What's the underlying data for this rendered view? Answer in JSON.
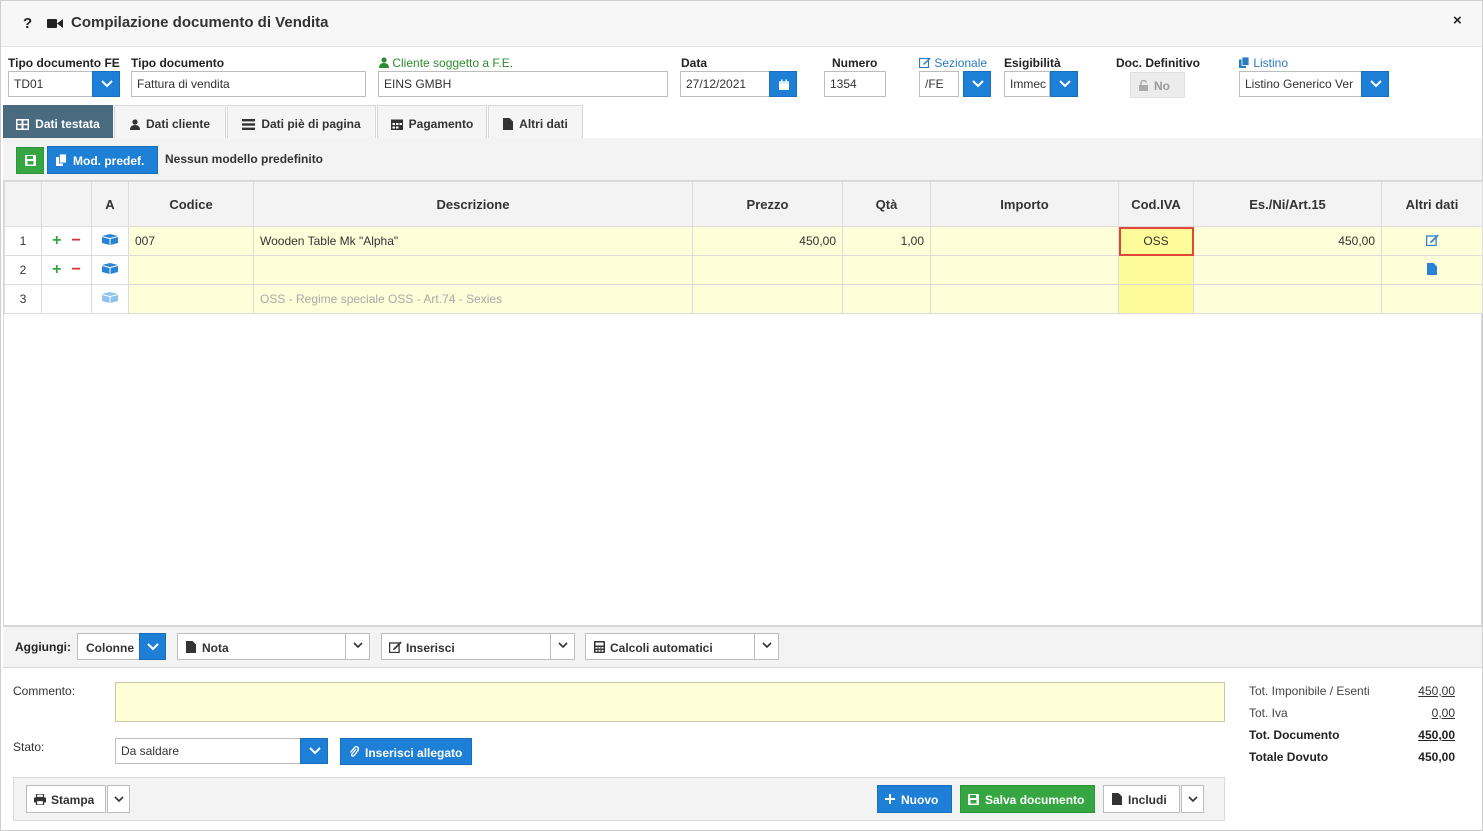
{
  "window": {
    "title": "Compilazione documento di Vendita",
    "help": "?",
    "close": "×"
  },
  "header": {
    "tipo_fe": {
      "label": "Tipo documento FE",
      "value": "TD01"
    },
    "tipo_doc": {
      "label": "Tipo documento",
      "value": "Fattura di vendita"
    },
    "cliente": {
      "label": "Cliente soggetto a F.E.",
      "value": "EINS GMBH"
    },
    "data": {
      "label": "Data",
      "value": "27/12/2021"
    },
    "numero": {
      "label": "Numero",
      "value": "1354"
    },
    "sezionale": {
      "label": "Sezionale",
      "value": "/FE"
    },
    "esigibilita": {
      "label": "Esigibilità",
      "value": "Immec"
    },
    "definitivo": {
      "label": "Doc. Definitivo",
      "value": "No"
    },
    "listino": {
      "label": "Listino",
      "value": "Listino Generico Ver"
    }
  },
  "tabs": [
    "Dati testata",
    "Dati cliente",
    "Dati piè di pagina",
    "Pagamento",
    "Altri dati"
  ],
  "toolbar": {
    "mod_predef": "Mod. predef.",
    "no_model": "Nessun modello predefinito"
  },
  "grid": {
    "columns": [
      "",
      "",
      "A",
      "Codice",
      "Descrizione",
      "Prezzo",
      "Qtà",
      "Importo",
      "Cod.IVA",
      "Es./Ni/Art.15",
      "Altri dati"
    ],
    "rows": [
      {
        "n": "1",
        "codice": "007",
        "descrizione": "Wooden Table Mk \"Alpha\"",
        "prezzo": "450,00",
        "qta": "1,00",
        "importo": "",
        "iva": "OSS",
        "es": "450,00"
      },
      {
        "n": "2",
        "codice": "",
        "descrizione": "",
        "prezzo": "",
        "qta": "",
        "importo": "",
        "iva": "",
        "es": ""
      },
      {
        "n": "3",
        "codice": "",
        "descrizione": "OSS - Regime speciale OSS - Art.74 - Sexies",
        "prezzo": "",
        "qta": "",
        "importo": "",
        "iva": "",
        "es": ""
      }
    ]
  },
  "aggiungi": {
    "label": "Aggiungi:",
    "colonne": "Colonne",
    "nota": "Nota",
    "inserisci": "Inserisci",
    "calcoli": "Calcoli automatici"
  },
  "bottom": {
    "commento_label": "Commento:",
    "stato_label": "Stato:",
    "stato_value": "Da saldare",
    "allegato": "Inserisci allegato"
  },
  "totals": [
    {
      "label": "Tot. Imponibile / Esenti",
      "value": "450,00"
    },
    {
      "label": "Tot. Iva",
      "value": "0,00"
    },
    {
      "label": "Tot. Documento",
      "value": "450,00"
    },
    {
      "label": "Totale Dovuto",
      "value": "450,00"
    }
  ],
  "footer": {
    "stampa": "Stampa",
    "nuovo": "Nuovo",
    "salva": "Salva documento",
    "includi": "Includi"
  },
  "colors": {
    "accent": "#1e7fd6",
    "green": "#35a641",
    "tab_active": "#4a6a80",
    "row_yellow": "#fefed8",
    "iva_yellow": "#fdfb9a",
    "selection": "#e0473a"
  }
}
